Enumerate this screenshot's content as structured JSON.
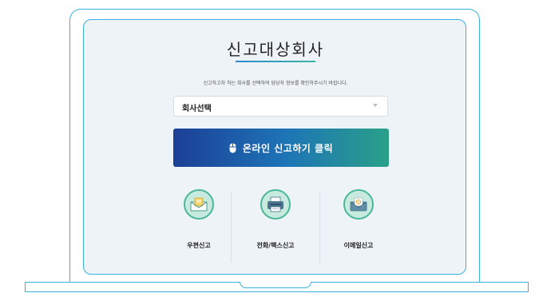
{
  "page": {
    "title": "신고대상회사",
    "subtitle": "신고하고자 하는 회사를 선택하여 담당자 정보를 확인하주시기 바랍니다."
  },
  "company_select": {
    "value": "회사선택"
  },
  "cta": {
    "label": "온라인 신고하기 클릭",
    "icon": "mouse-icon"
  },
  "report_methods": [
    {
      "label": "우편신고",
      "icon": "envelope-icon"
    },
    {
      "label": "전화/팩스신고",
      "icon": "fax-icon"
    },
    {
      "label": "이메일신고",
      "icon": "email-icon"
    }
  ],
  "colors": {
    "frame": "#3ab0de",
    "cta_start": "#1c3f96",
    "cta_end": "#2aa089",
    "icon_circle": "#c6eadd"
  }
}
